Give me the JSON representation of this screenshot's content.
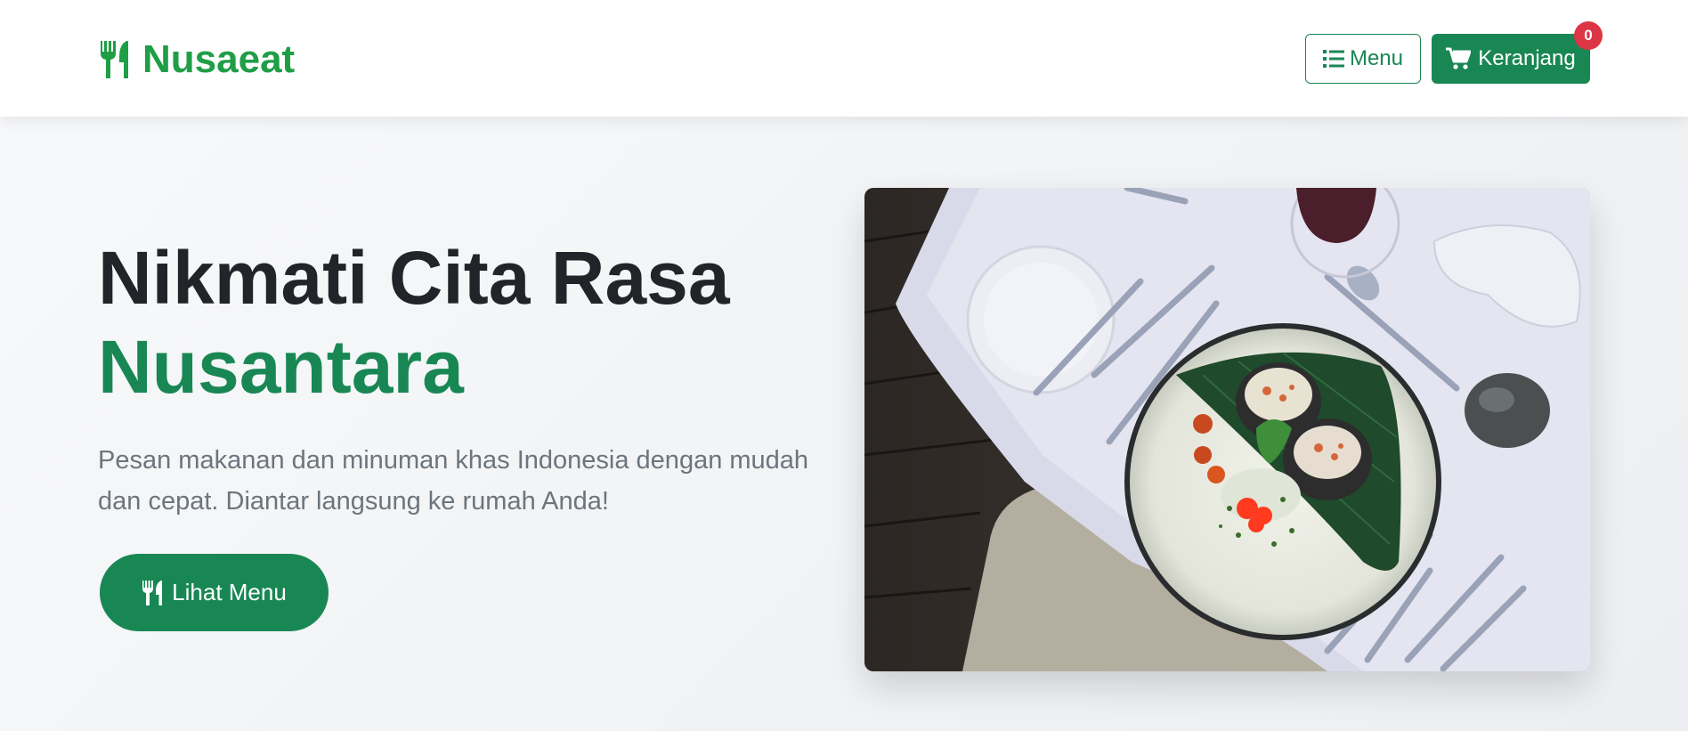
{
  "navbar": {
    "brand": "Nusaeat",
    "menu_button": "Menu",
    "cart_button": "Keranjang",
    "cart_count": "0"
  },
  "hero": {
    "title_line1": "Nikmati Cita Rasa",
    "title_line2": "Nusantara",
    "description": "Pesan makanan dan minuman khas Indonesia dengan mudah dan cepat. Diantar langsung ke rumah Anda!",
    "cta_label": "Lihat Menu",
    "image_alt": "Hidangan di atas meja"
  },
  "colors": {
    "brand_green": "#198754",
    "logo_green": "#1f9e46",
    "badge_red": "#dc3545",
    "text_dark": "#212529",
    "text_muted": "#6c757d"
  },
  "icons": {
    "brand": "utensils-icon",
    "menu": "list-icon",
    "cart": "cart-icon",
    "cta": "utensils-icon"
  }
}
